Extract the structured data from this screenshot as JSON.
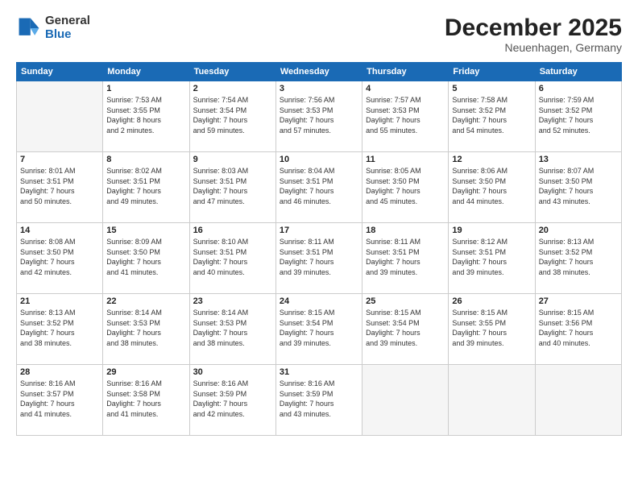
{
  "logo": {
    "line1": "General",
    "line2": "Blue"
  },
  "title": "December 2025",
  "location": "Neuenhagen, Germany",
  "weekdays": [
    "Sunday",
    "Monday",
    "Tuesday",
    "Wednesday",
    "Thursday",
    "Friday",
    "Saturday"
  ],
  "weeks": [
    [
      {
        "day": "",
        "lines": []
      },
      {
        "day": "1",
        "lines": [
          "Sunrise: 7:53 AM",
          "Sunset: 3:55 PM",
          "Daylight: 8 hours",
          "and 2 minutes."
        ]
      },
      {
        "day": "2",
        "lines": [
          "Sunrise: 7:54 AM",
          "Sunset: 3:54 PM",
          "Daylight: 7 hours",
          "and 59 minutes."
        ]
      },
      {
        "day": "3",
        "lines": [
          "Sunrise: 7:56 AM",
          "Sunset: 3:53 PM",
          "Daylight: 7 hours",
          "and 57 minutes."
        ]
      },
      {
        "day": "4",
        "lines": [
          "Sunrise: 7:57 AM",
          "Sunset: 3:53 PM",
          "Daylight: 7 hours",
          "and 55 minutes."
        ]
      },
      {
        "day": "5",
        "lines": [
          "Sunrise: 7:58 AM",
          "Sunset: 3:52 PM",
          "Daylight: 7 hours",
          "and 54 minutes."
        ]
      },
      {
        "day": "6",
        "lines": [
          "Sunrise: 7:59 AM",
          "Sunset: 3:52 PM",
          "Daylight: 7 hours",
          "and 52 minutes."
        ]
      }
    ],
    [
      {
        "day": "7",
        "lines": [
          "Sunrise: 8:01 AM",
          "Sunset: 3:51 PM",
          "Daylight: 7 hours",
          "and 50 minutes."
        ]
      },
      {
        "day": "8",
        "lines": [
          "Sunrise: 8:02 AM",
          "Sunset: 3:51 PM",
          "Daylight: 7 hours",
          "and 49 minutes."
        ]
      },
      {
        "day": "9",
        "lines": [
          "Sunrise: 8:03 AM",
          "Sunset: 3:51 PM",
          "Daylight: 7 hours",
          "and 47 minutes."
        ]
      },
      {
        "day": "10",
        "lines": [
          "Sunrise: 8:04 AM",
          "Sunset: 3:51 PM",
          "Daylight: 7 hours",
          "and 46 minutes."
        ]
      },
      {
        "day": "11",
        "lines": [
          "Sunrise: 8:05 AM",
          "Sunset: 3:50 PM",
          "Daylight: 7 hours",
          "and 45 minutes."
        ]
      },
      {
        "day": "12",
        "lines": [
          "Sunrise: 8:06 AM",
          "Sunset: 3:50 PM",
          "Daylight: 7 hours",
          "and 44 minutes."
        ]
      },
      {
        "day": "13",
        "lines": [
          "Sunrise: 8:07 AM",
          "Sunset: 3:50 PM",
          "Daylight: 7 hours",
          "and 43 minutes."
        ]
      }
    ],
    [
      {
        "day": "14",
        "lines": [
          "Sunrise: 8:08 AM",
          "Sunset: 3:50 PM",
          "Daylight: 7 hours",
          "and 42 minutes."
        ]
      },
      {
        "day": "15",
        "lines": [
          "Sunrise: 8:09 AM",
          "Sunset: 3:50 PM",
          "Daylight: 7 hours",
          "and 41 minutes."
        ]
      },
      {
        "day": "16",
        "lines": [
          "Sunrise: 8:10 AM",
          "Sunset: 3:51 PM",
          "Daylight: 7 hours",
          "and 40 minutes."
        ]
      },
      {
        "day": "17",
        "lines": [
          "Sunrise: 8:11 AM",
          "Sunset: 3:51 PM",
          "Daylight: 7 hours",
          "and 39 minutes."
        ]
      },
      {
        "day": "18",
        "lines": [
          "Sunrise: 8:11 AM",
          "Sunset: 3:51 PM",
          "Daylight: 7 hours",
          "and 39 minutes."
        ]
      },
      {
        "day": "19",
        "lines": [
          "Sunrise: 8:12 AM",
          "Sunset: 3:51 PM",
          "Daylight: 7 hours",
          "and 39 minutes."
        ]
      },
      {
        "day": "20",
        "lines": [
          "Sunrise: 8:13 AM",
          "Sunset: 3:52 PM",
          "Daylight: 7 hours",
          "and 38 minutes."
        ]
      }
    ],
    [
      {
        "day": "21",
        "lines": [
          "Sunrise: 8:13 AM",
          "Sunset: 3:52 PM",
          "Daylight: 7 hours",
          "and 38 minutes."
        ]
      },
      {
        "day": "22",
        "lines": [
          "Sunrise: 8:14 AM",
          "Sunset: 3:53 PM",
          "Daylight: 7 hours",
          "and 38 minutes."
        ]
      },
      {
        "day": "23",
        "lines": [
          "Sunrise: 8:14 AM",
          "Sunset: 3:53 PM",
          "Daylight: 7 hours",
          "and 38 minutes."
        ]
      },
      {
        "day": "24",
        "lines": [
          "Sunrise: 8:15 AM",
          "Sunset: 3:54 PM",
          "Daylight: 7 hours",
          "and 39 minutes."
        ]
      },
      {
        "day": "25",
        "lines": [
          "Sunrise: 8:15 AM",
          "Sunset: 3:54 PM",
          "Daylight: 7 hours",
          "and 39 minutes."
        ]
      },
      {
        "day": "26",
        "lines": [
          "Sunrise: 8:15 AM",
          "Sunset: 3:55 PM",
          "Daylight: 7 hours",
          "and 39 minutes."
        ]
      },
      {
        "day": "27",
        "lines": [
          "Sunrise: 8:15 AM",
          "Sunset: 3:56 PM",
          "Daylight: 7 hours",
          "and 40 minutes."
        ]
      }
    ],
    [
      {
        "day": "28",
        "lines": [
          "Sunrise: 8:16 AM",
          "Sunset: 3:57 PM",
          "Daylight: 7 hours",
          "and 41 minutes."
        ]
      },
      {
        "day": "29",
        "lines": [
          "Sunrise: 8:16 AM",
          "Sunset: 3:58 PM",
          "Daylight: 7 hours",
          "and 41 minutes."
        ]
      },
      {
        "day": "30",
        "lines": [
          "Sunrise: 8:16 AM",
          "Sunset: 3:59 PM",
          "Daylight: 7 hours",
          "and 42 minutes."
        ]
      },
      {
        "day": "31",
        "lines": [
          "Sunrise: 8:16 AM",
          "Sunset: 3:59 PM",
          "Daylight: 7 hours",
          "and 43 minutes."
        ]
      },
      {
        "day": "",
        "lines": []
      },
      {
        "day": "",
        "lines": []
      },
      {
        "day": "",
        "lines": []
      }
    ]
  ]
}
